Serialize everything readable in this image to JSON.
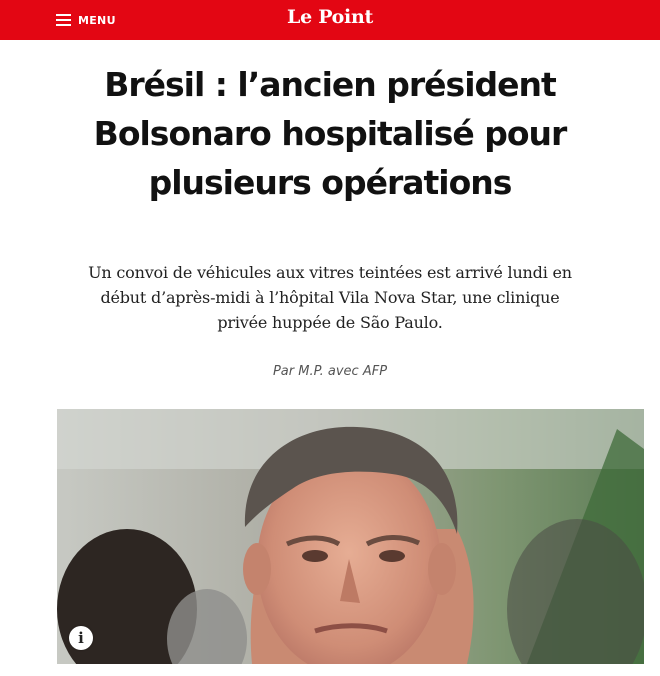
{
  "header": {
    "menu_label": "MENU",
    "menu_icon": "hamburger-icon",
    "logo_text": "Le Point",
    "brand_color": "#e30613"
  },
  "article": {
    "title_lines": [
      "Brésil : l’ancien président",
      "Bolsonaro hospitalisé pour",
      "plusieurs opérations"
    ],
    "lead_lines": [
      "Un convoi de véhicules aux vitres teintées est arrivé lundi en",
      "début d’après-midi à l’hôpital Vila Nova Star, une clinique",
      "privée huppée de São Paulo."
    ],
    "byline": "Par M.P. avec AFP"
  },
  "photo": {
    "info_icon_glyph": "i",
    "info_icon": "info-icon"
  }
}
